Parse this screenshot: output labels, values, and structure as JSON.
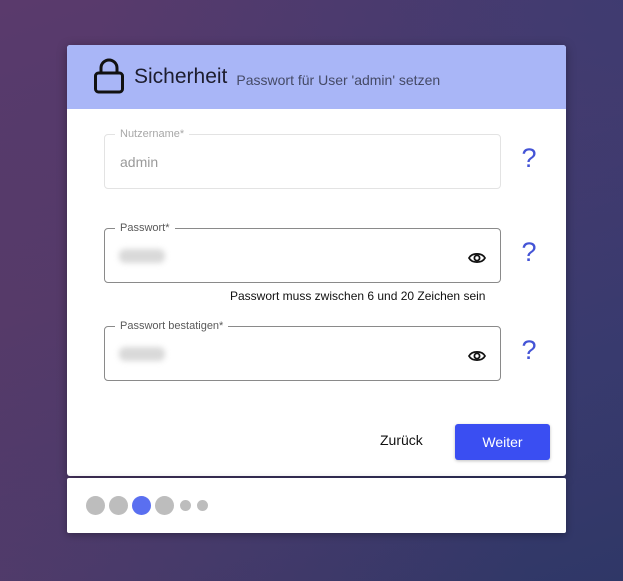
{
  "header": {
    "title": "Sicherheit",
    "subtitle": "Passwort für User 'admin' setzen"
  },
  "fields": {
    "username": {
      "label": "Nutzername*",
      "value": "admin",
      "disabled": true
    },
    "password": {
      "label": "Passwort*",
      "value_masked": true
    },
    "password_confirm": {
      "label": "Passwort bestatigen*",
      "value_masked": true
    }
  },
  "help": {
    "glyph": "?"
  },
  "hint": {
    "password": "Passwort muss zwischen 6 und 20 Zeichen sein"
  },
  "actions": {
    "back_label": "Zurück",
    "next_label": "Weiter"
  },
  "stepper": {
    "steps": 6,
    "current_step": 3
  },
  "colors": {
    "header_bg": "#a9b6f7",
    "accent": "#3a4ef2",
    "help_icon": "#4454d6",
    "step_active": "#5a6ff0",
    "step_inactive": "#bdbdbd"
  },
  "icons": [
    "lock-icon",
    "eye-icon",
    "help-icon"
  ]
}
